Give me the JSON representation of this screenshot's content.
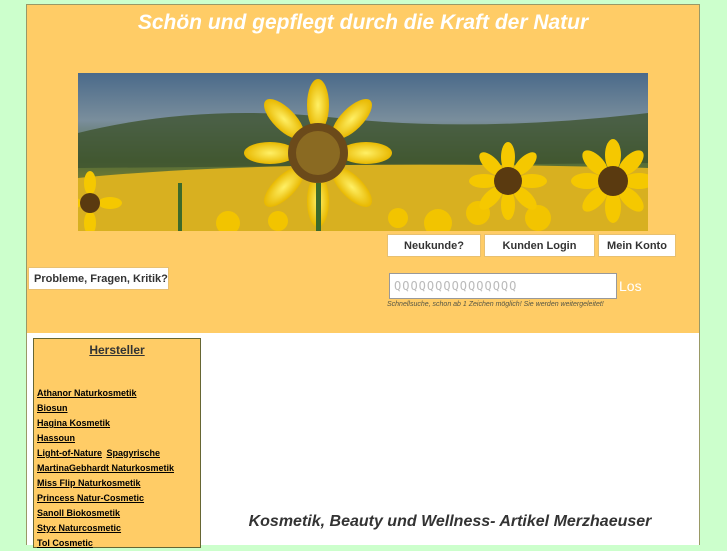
{
  "header": {
    "title": "Schön und gepflegt durch die Kraft der Natur",
    "nav": {
      "new_customer": "Neukunde?",
      "login": "Kunden Login",
      "account": "Mein Konto",
      "feedback": "Probleme, Fragen, Kritik?"
    },
    "search": {
      "value": "QQQQQQQQQQQQQQQ",
      "go_label": "Los",
      "hint": "Schnellsuche, schon ab 1 Zeichen möglich! Sie werden weitergeleitet!"
    }
  },
  "sidebar": {
    "title": "Hersteller",
    "brands": [
      "Athanor Naturkosmetik",
      "Biosun",
      "Hagina Kosmetik",
      "Hassoun",
      "Light-of-Nature",
      "MartinaGebhardt Naturkosmetik",
      "Miss Flip Naturkosmetik",
      "Princess Natur-Cosmetic",
      "Sanoll Biokosmetik",
      "Styx Naturcosmetic",
      "Tol Cosmetic"
    ],
    "brand_extra": "Spagyrische"
  },
  "main": {
    "heading": "Kosmetik, Beauty und Wellness- Artikel Merzhaeuser"
  }
}
